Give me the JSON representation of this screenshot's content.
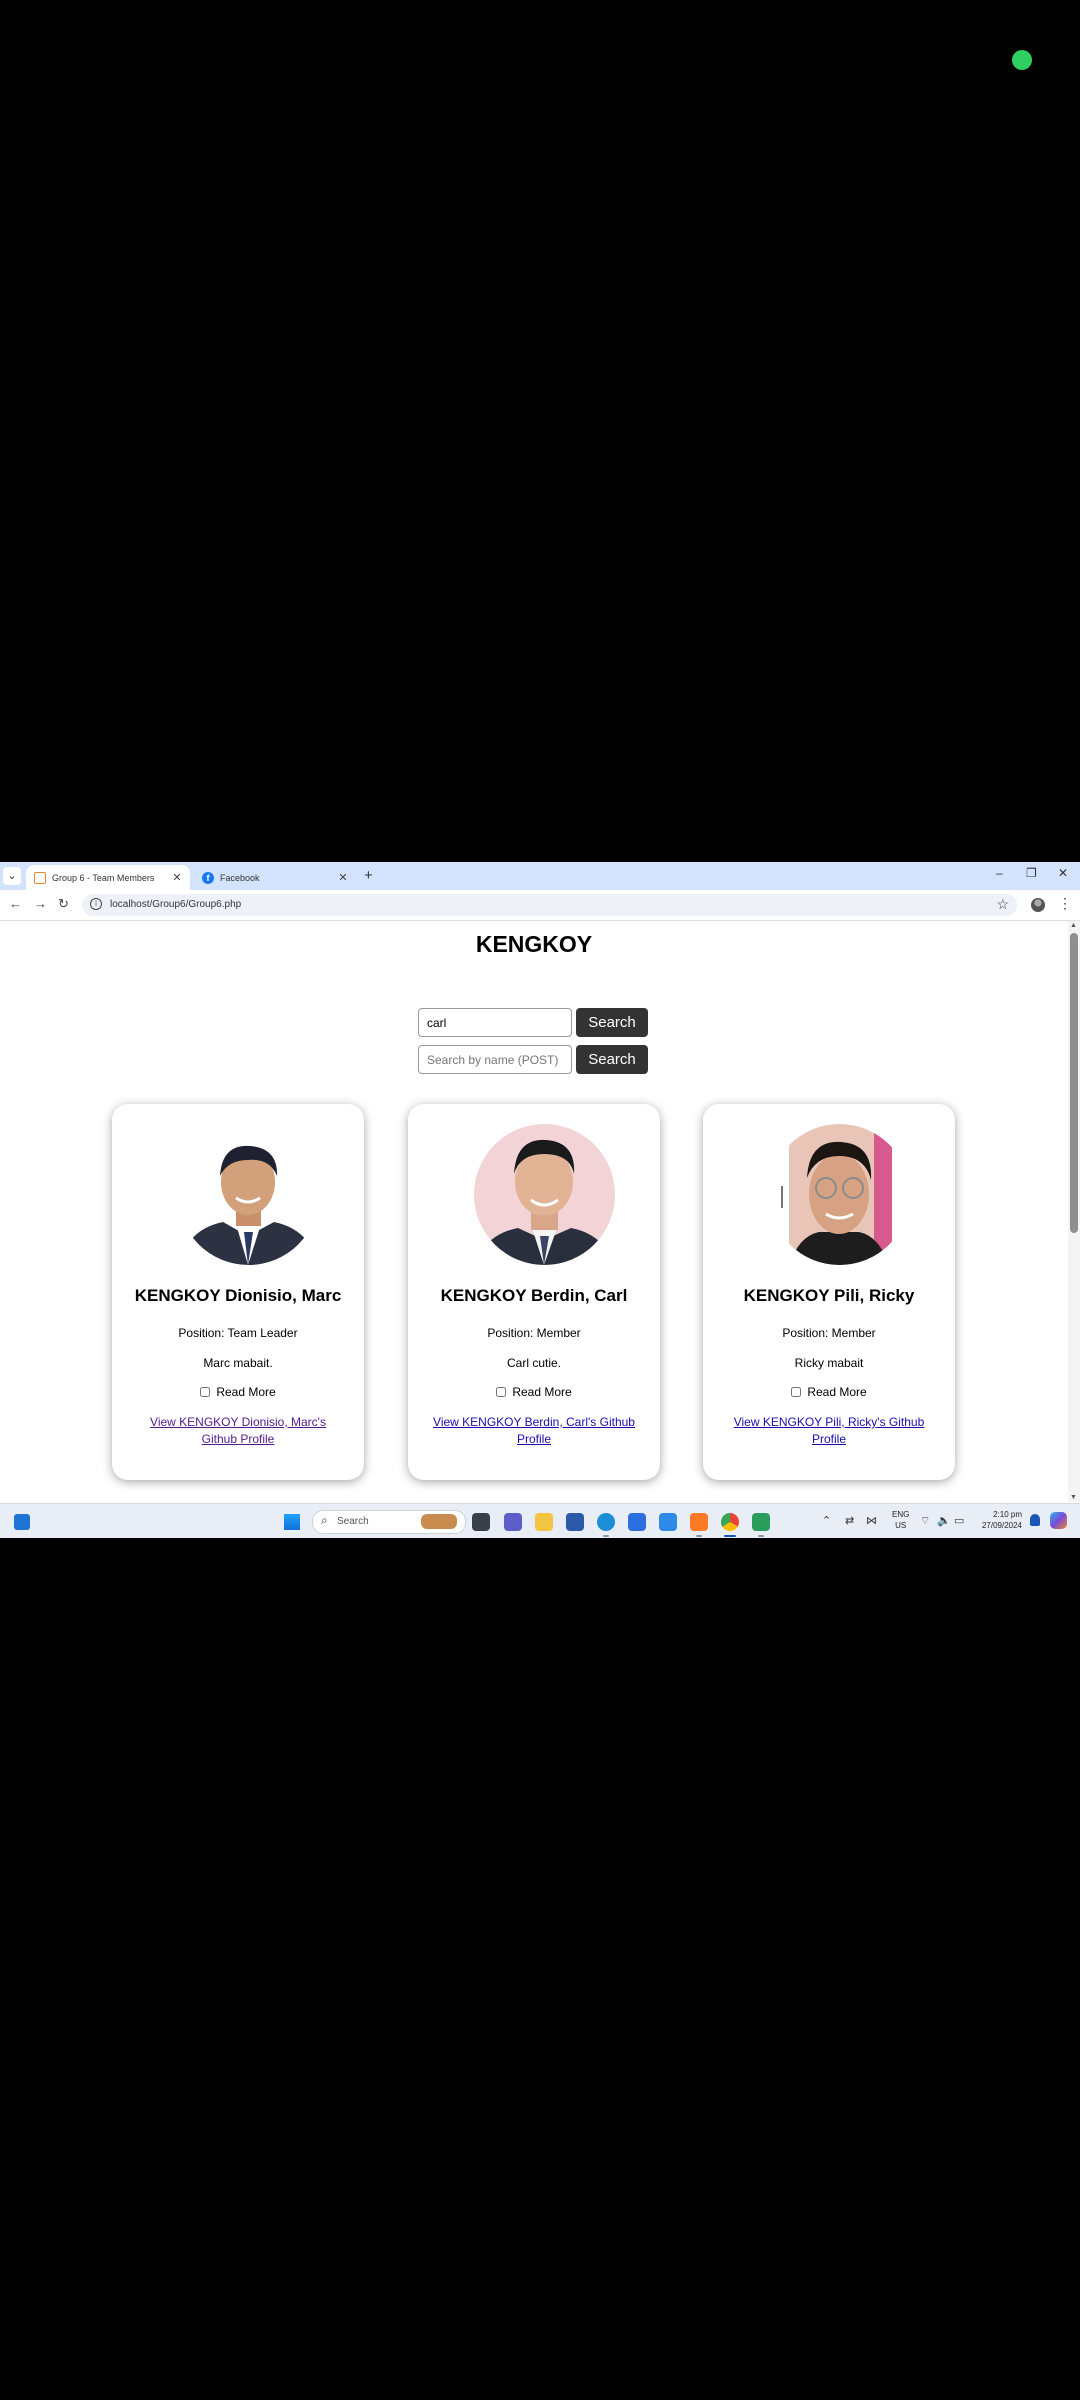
{
  "browser": {
    "tabs": [
      {
        "title": "Group 6 - Team Members",
        "active": true,
        "favicon": "group6-favicon"
      },
      {
        "title": "Facebook",
        "active": false,
        "favicon": "facebook-favicon"
      }
    ],
    "new_tab_label": "+",
    "url": "localhost/Group6/Group6.php"
  },
  "page": {
    "title": "KENGKOY",
    "get_search": {
      "value": "carl",
      "button_label": "Search"
    },
    "post_search": {
      "placeholder": "Search by name (POST)",
      "button_label": "Search"
    },
    "members": [
      {
        "name": "KENGKOY Dionisio, Marc",
        "position": "Position: Team Leader",
        "description": "Marc mabait.",
        "read_more": "Read More",
        "github_link": "View KENGKOY Dionisio, Marc's Github Profile",
        "link_visited": true
      },
      {
        "name": "KENGKOY Berdin, Carl",
        "position": "Position: Member",
        "description": "Carl cutie.",
        "read_more": "Read More",
        "github_link": "View KENGKOY Berdin, Carl's Github Profile",
        "link_visited": false
      },
      {
        "name": "KENGKOY Pili, Ricky",
        "position": "Position: Member",
        "description": "Ricky mabait",
        "read_more": "Read More",
        "github_link": "View KENGKOY Pili, Ricky's Github Profile",
        "link_visited": false
      }
    ]
  },
  "taskbar": {
    "search_label": "Search",
    "language": "ENG",
    "region": "US",
    "time": "2:10 pm",
    "date": "27/09/2024"
  },
  "colors": {
    "accent_indicator": "#2fd062",
    "tab_strip": "#d3e3fd",
    "button_dark": "#333333",
    "link": "#1a0dab",
    "link_visited": "#551a8b"
  }
}
